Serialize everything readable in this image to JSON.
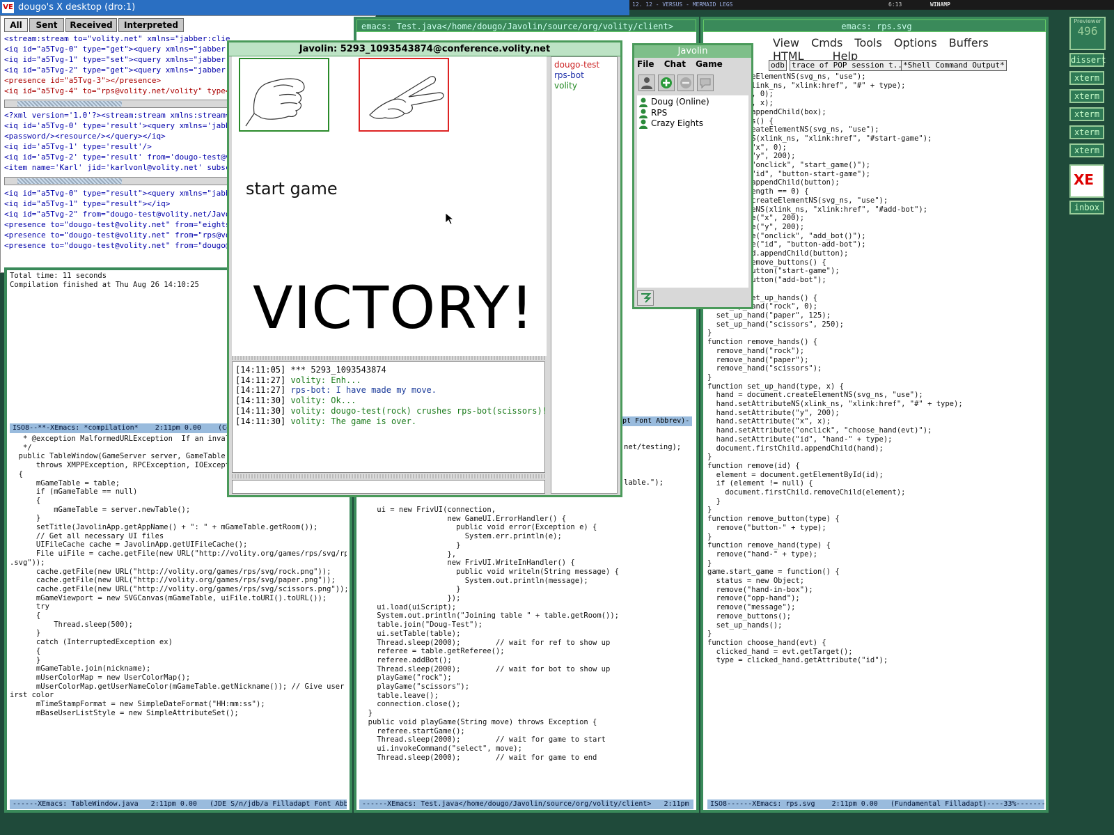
{
  "desktop": {
    "title": "dougo's X desktop (dro:1)",
    "logo": "VE",
    "winamp_title": "12. 12 - VERSUS - MERMAID LEGS",
    "winamp_time": "6:13",
    "winamp_label": "WINAMP"
  },
  "xml_console": {
    "tabs": [
      "All",
      "Sent",
      "Received",
      "Interpreted"
    ],
    "pane1": [
      "<stream:stream to=\"volity.net\" xmlns=\"jabber:client\" xmlns:stream=\"http://etherx.jab",
      "<iq id=\"a5Tvg-0\" type=\"get\"><query xmlns=\"jabber:iq:auth\"><username>dougo</u",
      "<iq id=\"a5Tvg-1\" type=\"set\"><query xmlns=\"jabber:iq:auth\"><username>dougo</u",
      "<iq id=\"a5Tvg-2\" type=\"get\"><query xmlns=\"jabber:iq:roster\"></query></iq>",
      "<presence id=\"a5Tvg-3\"></presence>",
      "<iq id=\"a5Tvg-4\" to=\"rps@volity.net/volity\" type=\"set\"><query xmlns"
    ],
    "pane2": [
      "<?xml version='1.0'?><stream:stream xmlns:stream='http://",
      "<iq id='a5Tvg-0' type='result'><query xmlns='jabber:iq:auth'>",
      "<password/><resource/></query></iq>",
      "<iq id='a5Tvg-1' type='result'/>",
      "<iq id='a5Tvg-2' type='result' from='dougo-test@volity.net",
      "<item name='Karl' jid='karlvonl@volity.net' subscription='both"
    ],
    "pane3": [
      "<iq id=\"a5Tvg-0\" type=\"result\"><query xmlns=\"jabber:iq",
      "<iq id=\"a5Tvg-1\" type=\"result\"></iq>",
      "<iq id=\"a5Tvg-2\" from=\"dougo-test@volity.net/Javolin\"",
      "<presence to=\"dougo-test@volity.net\" from=\"eights@volity",
      "<presence to=\"dougo-test@volity.net\" from=\"rps@volity",
      "<presence to=\"dougo-test@volity.net\" from=\"dougo@volity"
    ]
  },
  "emacs_left": {
    "compilation": [
      "Total time: 11 seconds",
      "",
      "Compilation finished at Thu Aug 26 14:10:25"
    ],
    "modeline1": "ISO8--**-XEmacs: *compilation*    2:11pm 0.00    (Comp",
    "code": [
      "   * @exception MalformedURLException  If an invali",
      "   */",
      "  public TableWindow(GameServer server, GameTable t",
      "      throws XMPPException, RPCException, IOExcept",
      "  {",
      "      mGameTable = table;",
      "",
      "      if (mGameTable == null)",
      "      {",
      "          mGameTable = server.newTable();",
      "      }",
      "",
      "      setTitle(JavolinApp.getAppName() + \": \" + mGameTable.getRoom());",
      "",
      "      // Get all necessary UI files",
      "      UIFileCache cache = JavolinApp.getUIFileCache();",
      "      File uiFile = cache.getFile(new URL(\"http://volity.org/games/rps/svg/rps",
      ".svg\"));",
      "      cache.getFile(new URL(\"http://volity.org/games/rps/svg/rock.png\"));",
      "      cache.getFile(new URL(\"http://volity.org/games/rps/svg/paper.png\"));",
      "      cache.getFile(new URL(\"http://volity.org/games/rps/svg/scissors.png\"));",
      "",
      "      mGameViewport = new SVGCanvas(mGameTable, uiFile.toURI().toURL());",
      "      try",
      "      {",
      "          Thread.sleep(500);",
      "      }",
      "      catch (InterruptedException ex)",
      "      {",
      "      }",
      "",
      "      mGameTable.join(nickname);",
      "",
      "      mUserColorMap = new UserColorMap();",
      "      mUserColorMap.getUserNameColor(mGameTable.getNickname()); // Give user f",
      "irst color",
      "",
      "      mTimeStampFormat = new SimpleDateFormat(\"HH:mm:ss\");",
      "",
      "      mBaseUserListStyle = new SimpleAttributeSet();"
    ],
    "modeline2": "------XEmacs: TableWindow.java   2:11pm 0.00   (JDE S/n/jdb/a Filladapt Font Abb"
  },
  "emacs_mid": {
    "title": "emacs: Test.java</home/dougo/Javolin/source/org/volity/client>",
    "code": [
      "    ui = new FrivUI(connection,",
      "                    new GameUI.ErrorHandler() {",
      "                      public void error(Exception e) {",
      "                        System.err.println(e);",
      "                      }",
      "                    },",
      "                    new FrivUI.WriteInHandler() {",
      "                      public void writeln(String message) {",
      "                        System.out.println(message);",
      "                      }",
      "                    });",
      "    ui.load(uiScript);",
      "",
      "    System.out.println(\"Joining table \" + table.getRoom());",
      "    table.join(\"Doug-Test\");",
      "    ui.setTable(table);",
      "    Thread.sleep(2000);        // wait for ref to show up",
      "    referee = table.getReferee();",
      "    referee.addBot();",
      "    Thread.sleep(2000);        // wait for bot to show up",
      "    playGame(\"rock\");",
      "    playGame(\"scissors\");",
      "    table.leave();",
      "    connection.close();",
      "  }",
      "",
      "  public void playGame(String move) throws Exception {",
      "    referee.startGame();",
      "    Thread.sleep(2000);        // wait for game to start",
      "    ui.invokeCommand(\"select\", move);",
      "    Thread.sleep(2000);        // wait for game to end"
    ],
    "peek": [
      "net/testing);",
      "lable.\");",
      "pt Font Abbrev)-"
    ],
    "modeline": "------XEmacs: Test.java</home/dougo/Javolin/source/org/volity/client>   2:11pm 0"
  },
  "emacs_right": {
    "title": "emacs: rps.svg",
    "menu": [
      "View",
      "Cmds",
      "Tools",
      "Options",
      "Buffers",
      "HTML",
      "Help"
    ],
    "buffer_tabs": [
      "odb",
      "trace of POP session t...",
      "*Shell Command Output*"
    ],
    "code": [
      "ment.createElementNS(svg_ns, \"use\");",
      "ributeNS(xlink_ns, \"xlink:href\", \"#\" + type);",
      "ribute(\"y\", 0);",
      "ribute(\"x\", x);",
      "irstChild.appendChild(box);",
      "",
      "",
      "_up_buttons() {",
      "ocument.createElementNS(svg_ns, \"use\");",
      "AttributeNS(xlink_ns, \"xlink:href\", \"#start-game\");",
      "Attribute(\"x\", 0);",
      "Attribute(\"y\", 200);",
      "Attribute(\"onclick\", \"start_game()\");",
      "Attribute(\"id\", \"button-start-game\");",
      "irstChild.appendChild(button);",
      "",
      "pponents.length == 0) {",
      " document.createElementNS(svg_ns, \"use\");",
      "etAttributeNS(xlink_ns, \"xlink:href\", \"#add-bot\");",
      "etAttribute(\"x\", 200);",
      "etAttribute(\"y\", 200);",
      "etAttribute(\"onclick\", \"add_bot()\");",
      "etAttribute(\"id\", \"button-add-bot\");",
      ".firstChild.appendChild(button);",
      "",
      "",
      "",
      "function remove_buttons() {",
      "  remove_button(\"start-game\");",
      "  remove_button(\"add-bot\");",
      "}",
      "",
      "function set_up_hands() {",
      "  set_up_hand(\"rock\", 0);",
      "  set_up_hand(\"paper\", 125);",
      "  set_up_hand(\"scissors\", 250);",
      "}",
      "",
      "function remove_hands() {",
      "  remove_hand(\"rock\");",
      "  remove_hand(\"paper\");",
      "  remove_hand(\"scissors\");",
      "}",
      "",
      "function set_up_hand(type, x) {",
      "  hand = document.createElementNS(svg_ns, \"use\");",
      "  hand.setAttributeNS(xlink_ns, \"xlink:href\", \"#\" + type);",
      "  hand.setAttribute(\"y\", 200);",
      "  hand.setAttribute(\"x\", x);",
      "  hand.setAttribute(\"onclick\", \"choose_hand(evt)\");",
      "  hand.setAttribute(\"id\", \"hand-\" + type);",
      "  document.firstChild.appendChild(hand);",
      "}",
      "",
      "function remove(id) {",
      "  element = document.getElementById(id);",
      "  if (element != null) {",
      "    document.firstChild.removeChild(element);",
      "  }",
      "}",
      "",
      "function remove_button(type) {",
      "  remove(\"button-\" + type);",
      "}",
      "function remove_hand(type) {",
      "  remove(\"hand-\" + type);",
      "}",
      "",
      "game.start_game = function() {",
      "  status = new Object;",
      "  remove(\"hand-in-box\");",
      "  remove(\"opp-hand\");",
      "  remove(\"message\");",
      "  remove_buttons();",
      "  set_up_hands();",
      "}",
      "",
      "function choose_hand(evt) {",
      "  clicked_hand = evt.getTarget();",
      "  type = clicked_hand.getAttribute(\"id\");"
    ],
    "modeline": "ISO8------XEmacs: rps.svg    2:11pm 0.00   (Fundamental Filladapt)----33%----------"
  },
  "game_window": {
    "title": "Javolin: 5293_1093543874@conference.volity.net",
    "start_game": "start game",
    "victory": "VICTORY!",
    "users": [
      "dougo-test",
      "rps-bot",
      "volity"
    ],
    "chat": [
      {
        "time": "[14:11:05]",
        "text": "*** 5293_1093543874",
        "color": "#111111"
      },
      {
        "time": "[14:11:27]",
        "text": "volity: Enh...",
        "color": "#1a7a1a"
      },
      {
        "time": "[14:11:27]",
        "text": "rps-bot: I have made my move.",
        "color": "#1a3a9a"
      },
      {
        "time": "[14:11:30]",
        "text": "volity: Ok...",
        "color": "#1a7a1a"
      },
      {
        "time": "[14:11:30]",
        "text": "volity: dougo-test(rock) crushes rps-bot(scissors)!",
        "color": "#1a7a1a"
      },
      {
        "time": "[14:11:30]",
        "text": "volity: The game is over.",
        "color": "#1a7a1a"
      }
    ]
  },
  "roster": {
    "title": "Javolin",
    "menu": [
      "File",
      "Chat",
      "Game"
    ],
    "items": [
      "Doug (Online)",
      "RPS",
      "Crazy Eights"
    ]
  },
  "dock": {
    "previewer": "Previewer",
    "previewer_count": "496",
    "buttons": [
      "dissert",
      "xterm",
      "xterm",
      "xterm",
      "xterm",
      "xterm",
      "inbox"
    ],
    "xe_logo": "XE"
  },
  "colors": {
    "emacs_frame": "#3a8a5a",
    "modeline": "#99bbdd",
    "title_blue": "#2a6fc2"
  }
}
